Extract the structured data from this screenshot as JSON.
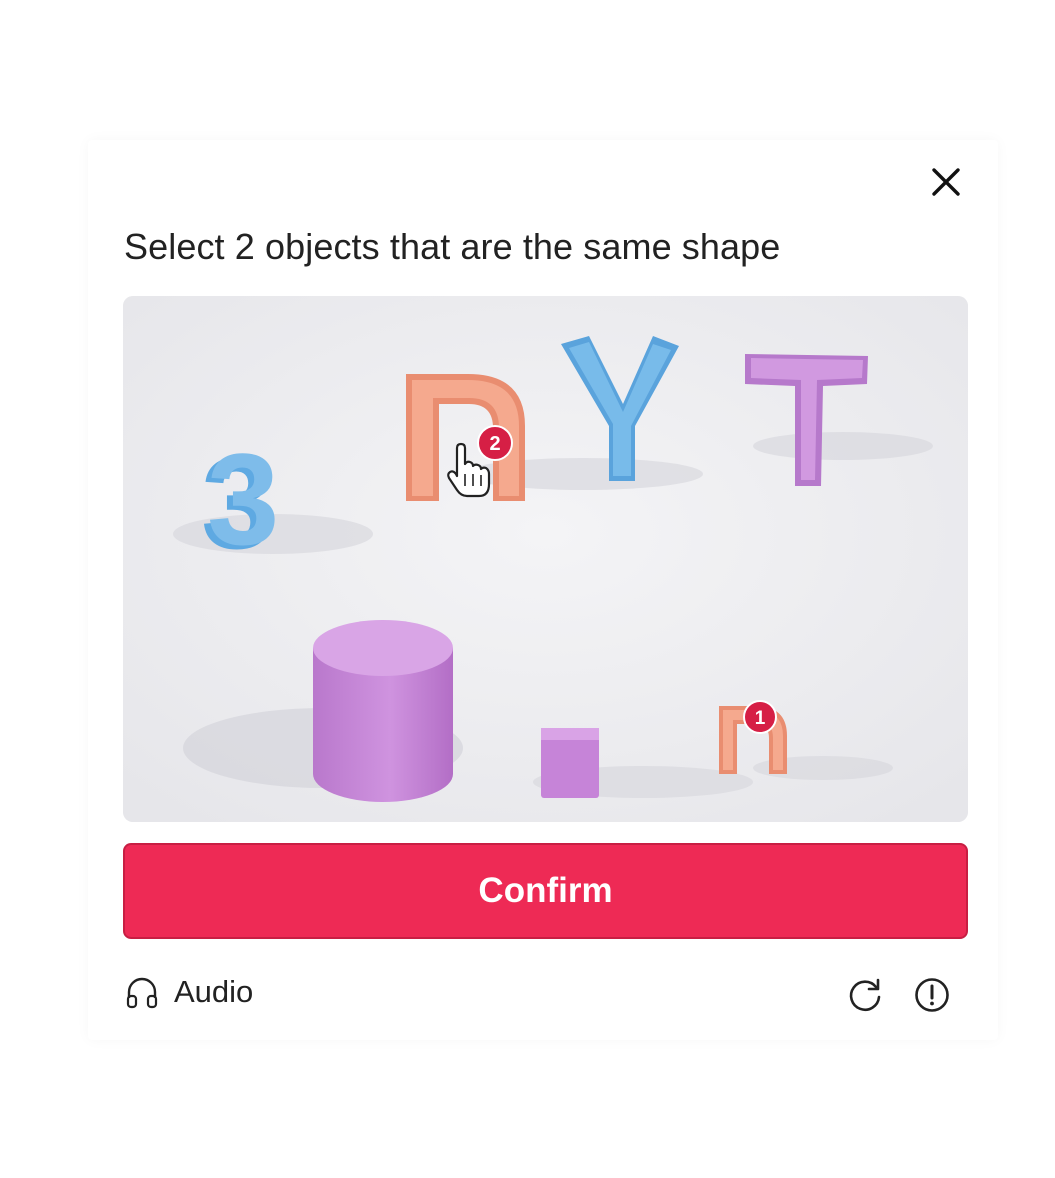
{
  "dialog": {
    "close_icon": "close-icon",
    "title": "Select 2 objects that are the same shape"
  },
  "puzzle": {
    "objects": [
      {
        "label": "3",
        "color": "#5aa8e0"
      },
      {
        "label": "n",
        "color": "#f29a7d",
        "marker": "2"
      },
      {
        "label": "Y",
        "color": "#6ab4e8"
      },
      {
        "label": "T",
        "color": "#c98ad6"
      },
      {
        "label": "cylinder",
        "color": "#c98ad6"
      },
      {
        "label": "cube",
        "color": "#c98ad6"
      },
      {
        "label": "n",
        "color": "#f29a7d",
        "marker": "1"
      }
    ],
    "selection_markers": [
      "2",
      "1"
    ],
    "marker_color": "#d61f45",
    "cursor_icon": "hand-pointer-icon"
  },
  "footer": {
    "confirm_label": "Confirm",
    "confirm_color": "#ee2a55",
    "audio_label": "Audio",
    "audio_icon": "headphones-icon",
    "refresh_icon": "refresh-icon",
    "report_icon": "info-alert-icon"
  }
}
